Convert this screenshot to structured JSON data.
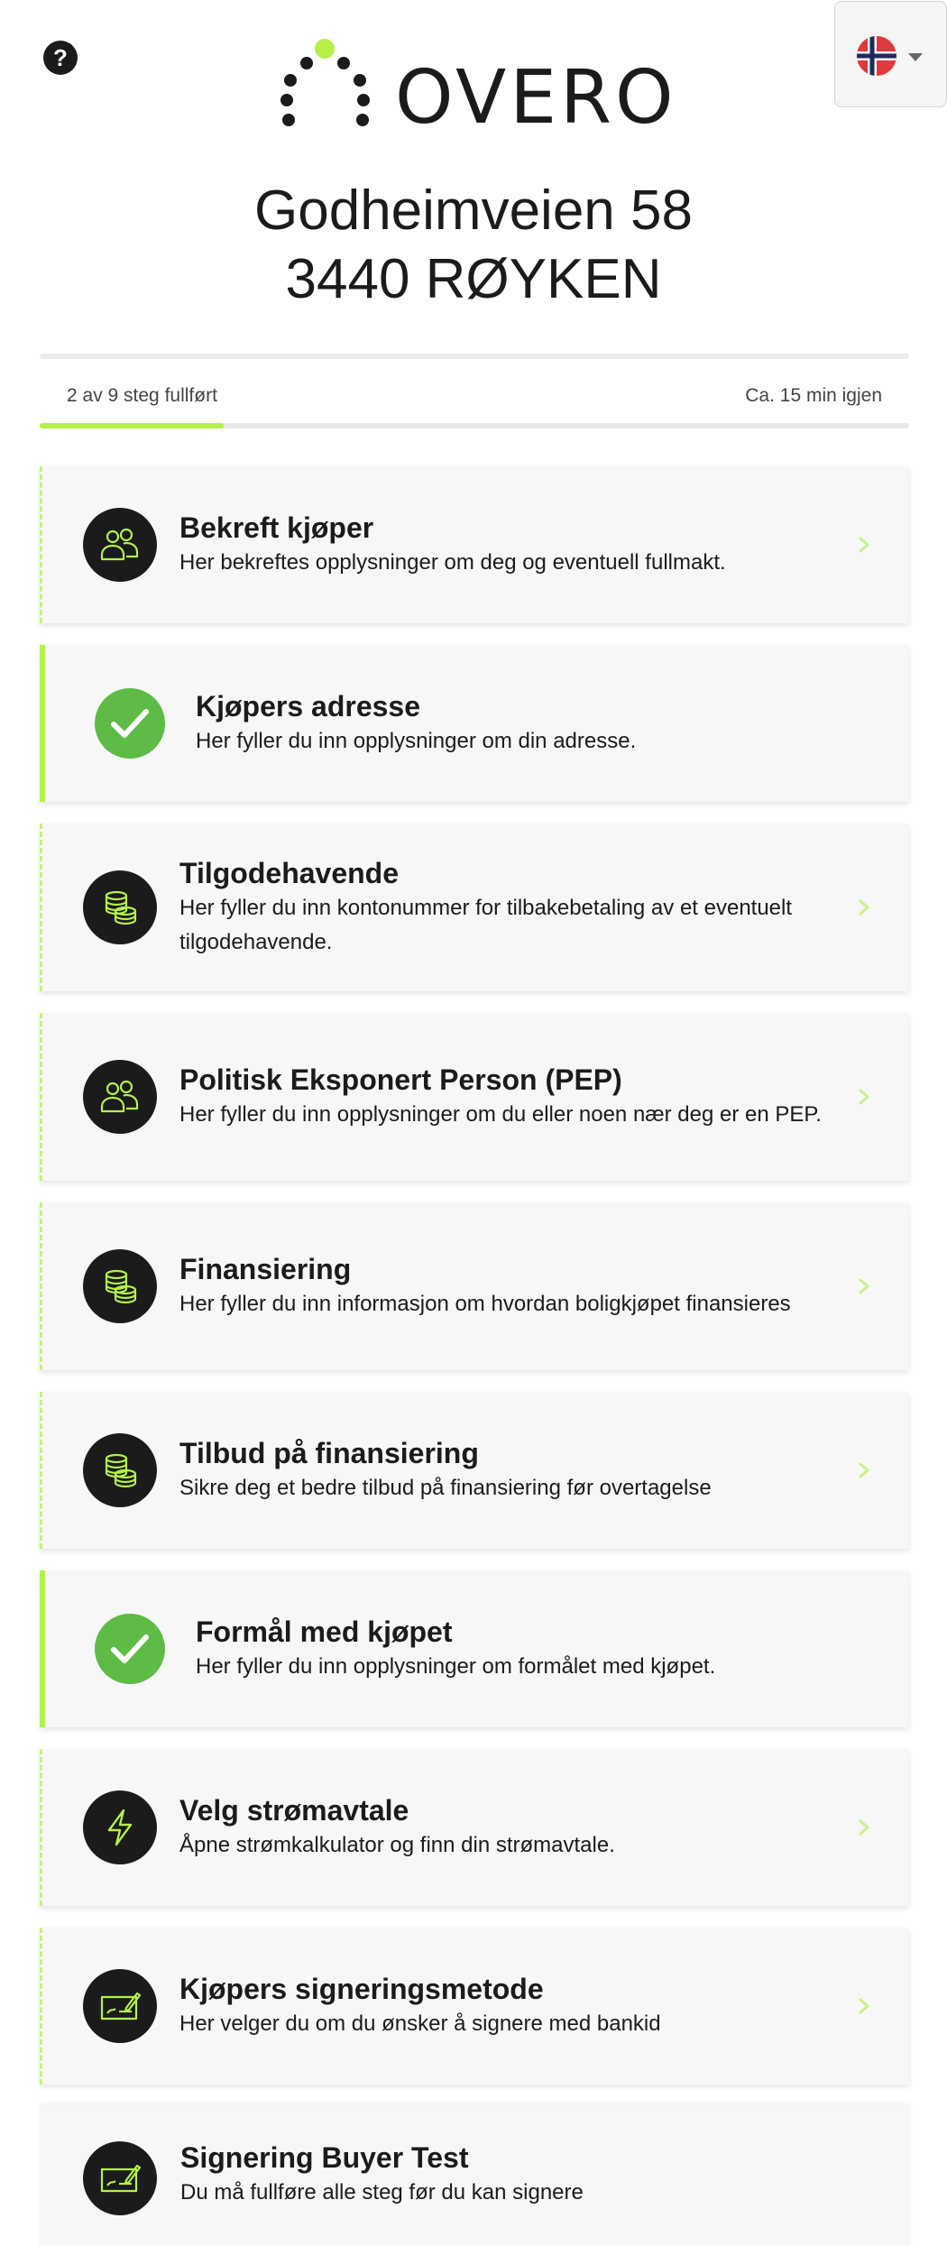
{
  "header": {
    "help_icon": "question-circle-icon",
    "logo_text": "OVERO",
    "language": {
      "flag": "norway-flag-icon",
      "caret": "caret-down-icon"
    }
  },
  "property": {
    "street": "Godheimveien 58",
    "postal": "3440 RØYKEN"
  },
  "progress": {
    "status_text": "2 av 9 steg fullført",
    "time_left": "Ca. 15 min igjen",
    "completed": 2,
    "total": 9
  },
  "colors": {
    "accent_green": "#b5f04b",
    "done_green": "#5dbb46",
    "icon_bg": "#1b1b1b"
  },
  "steps": [
    {
      "title": "Bekreft kjøper",
      "desc": "Her bekreftes opplysninger om deg og eventuell fullmakt.",
      "icon": "users-icon",
      "done": false
    },
    {
      "title": "Kjøpers adresse",
      "desc": "Her fyller du inn opplysninger om din adresse.",
      "icon": "checkmark-icon",
      "done": true
    },
    {
      "title": "Tilgodehavende",
      "desc": "Her fyller du inn kontonummer for tilbakebetaling av et eventuelt tilgodehavende.",
      "icon": "coins-icon",
      "done": false
    },
    {
      "title": "Politisk Eksponert Person (PEP)",
      "desc": "Her fyller du inn opplysninger om du eller noen nær deg er en PEP.",
      "icon": "users-icon",
      "done": false
    },
    {
      "title": "Finansiering",
      "desc": "Her fyller du inn informasjon om hvordan boligkjøpet finansieres",
      "icon": "coins-icon",
      "done": false
    },
    {
      "title": "Tilbud på finansiering",
      "desc": "Sikre deg et bedre tilbud på finansiering før overtagelse",
      "icon": "coins-icon",
      "done": false
    },
    {
      "title": "Formål med kjøpet",
      "desc": "Her fyller du inn opplysninger om formålet med kjøpet.",
      "icon": "checkmark-icon",
      "done": true
    },
    {
      "title": "Velg strømavtale",
      "desc": "Åpne strømkalkulator og finn din strømavtale.",
      "icon": "lightning-icon",
      "done": false
    },
    {
      "title": "Kjøpers signeringsmetode",
      "desc": "Her velger du om du ønsker å signere med bankid",
      "icon": "signature-icon",
      "done": false
    },
    {
      "title": "Signering Buyer Test",
      "desc": "Du må fullføre alle steg før du kan signere",
      "icon": "signature-icon",
      "done": false
    }
  ]
}
